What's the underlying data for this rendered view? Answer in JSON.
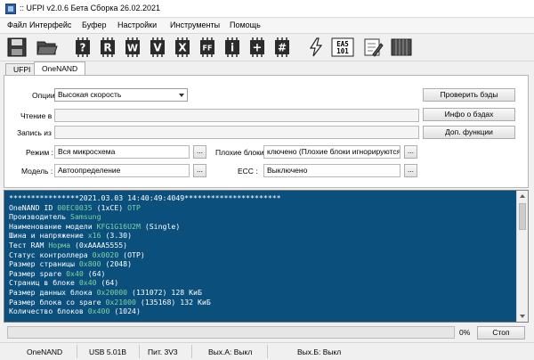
{
  "window": {
    "title": ":: UFPI v2.0.6 Бета Сборка 26.02.2021"
  },
  "menu": [
    "Файл",
    "Интерфейс",
    "Буфер",
    "Настройки",
    "Инструменты",
    "Помощь"
  ],
  "toolbar": {
    "icons": [
      {
        "name": "save-icon",
        "glyph": ""
      },
      {
        "name": "open-folder-icon",
        "glyph": ""
      },
      {
        "name": "help-chip-icon",
        "glyph": "?"
      },
      {
        "name": "read-chip-icon",
        "glyph": "R"
      },
      {
        "name": "write-chip-icon",
        "glyph": "W"
      },
      {
        "name": "verify-chip-icon",
        "glyph": "V"
      },
      {
        "name": "erase-chip-icon",
        "glyph": "X"
      },
      {
        "name": "blank-check-chip-icon",
        "glyph": "FF"
      },
      {
        "name": "info-chip-icon",
        "glyph": "i"
      },
      {
        "name": "add-chip-icon",
        "glyph": "+"
      },
      {
        "name": "checksum-chip-icon",
        "glyph": "#"
      },
      {
        "name": "lightning-icon",
        "glyph": ""
      },
      {
        "name": "ea5101-icon",
        "glyph": "EA5\n101"
      },
      {
        "name": "edit-note-icon",
        "glyph": ""
      },
      {
        "name": "hex-grid-icon",
        "glyph": ""
      }
    ]
  },
  "tabs": [
    {
      "label": "UFPI",
      "active": false
    },
    {
      "label": "OneNAND",
      "active": true
    }
  ],
  "form": {
    "options_label": "Опции :",
    "options_value": "Высокая скорость",
    "read_label": "Чтение в :",
    "read_value": "",
    "write_label": "Запись из :",
    "write_value": "",
    "mode_label": "Режим :",
    "mode_value": "Вся микросхема",
    "model_label": "Модель :",
    "model_value": "Автоопределение",
    "badblocks_label": "Плохие блоки :",
    "badblocks_value": "ключено (Плохие блоки игнорируются)",
    "ecc_label": "ECC :",
    "ecc_value": "Выключено",
    "dots": "...",
    "check_bads_btn": "Проверить бэды",
    "info_bads_btn": "Инфо о бэдах",
    "extra_funcs_btn": "Доп. функции"
  },
  "log": {
    "lines": [
      [
        {
          "t": "****************2021.03.03 14:40:49:4049**********************",
          "h": false
        }
      ],
      [
        {
          "t": "OneNAND ID ",
          "h": false
        },
        {
          "t": "00EC0035",
          "h": true
        },
        {
          "t": " (1xCE) ",
          "h": false
        },
        {
          "t": "OTP",
          "h": true
        }
      ],
      [
        {
          "t": "Производитель ",
          "h": false
        },
        {
          "t": "Samsung",
          "h": true
        }
      ],
      [
        {
          "t": "Наименование модели ",
          "h": false
        },
        {
          "t": "KFG1G16U2M",
          "h": true
        },
        {
          "t": " (Single)",
          "h": false
        }
      ],
      [
        {
          "t": "Шина и напряжение ",
          "h": false
        },
        {
          "t": "x16",
          "h": true
        },
        {
          "t": " (3.30)",
          "h": false
        }
      ],
      [
        {
          "t": "Тест RAM ",
          "h": false
        },
        {
          "t": "Норма",
          "h": true
        },
        {
          "t": " (0xAAAA5555)",
          "h": false
        }
      ],
      [
        {
          "t": "Статус контроллера ",
          "h": false
        },
        {
          "t": "0x0020",
          "h": true
        },
        {
          "t": " (OTP)",
          "h": false
        }
      ],
      [
        {
          "t": "Размер страницы ",
          "h": false
        },
        {
          "t": "0x800",
          "h": true
        },
        {
          "t": " (2048)",
          "h": false
        }
      ],
      [
        {
          "t": "Размер spare ",
          "h": false
        },
        {
          "t": "0x40",
          "h": true
        },
        {
          "t": " (64)",
          "h": false
        }
      ],
      [
        {
          "t": "Страниц в блоке ",
          "h": false
        },
        {
          "t": "0x40",
          "h": true
        },
        {
          "t": " (64)",
          "h": false
        }
      ],
      [
        {
          "t": "Размер данных блока ",
          "h": false
        },
        {
          "t": "0x20000",
          "h": true
        },
        {
          "t": " (131072) 128 КиБ",
          "h": false
        }
      ],
      [
        {
          "t": "Размер блока со spare ",
          "h": false
        },
        {
          "t": "0x21000",
          "h": true
        },
        {
          "t": " (135168) 132 КиБ",
          "h": false
        }
      ],
      [
        {
          "t": "Количество блоков ",
          "h": false
        },
        {
          "t": "0x400",
          "h": true
        },
        {
          "t": " (1024)",
          "h": false
        }
      ]
    ]
  },
  "progress": {
    "percent": 0,
    "label": "0%",
    "stop_label": "Стоп"
  },
  "status": {
    "device": "OneNAND",
    "usb": "USB 5.01B",
    "power": "Пит. 3V3",
    "out_a": "Вых.А: Выкл",
    "out_b": "Вых.Б: Выкл"
  },
  "colors": {
    "log_bg": "#0b4f7c",
    "log_highlight": "#7fd3a0",
    "progress_fill": "#06b025"
  }
}
